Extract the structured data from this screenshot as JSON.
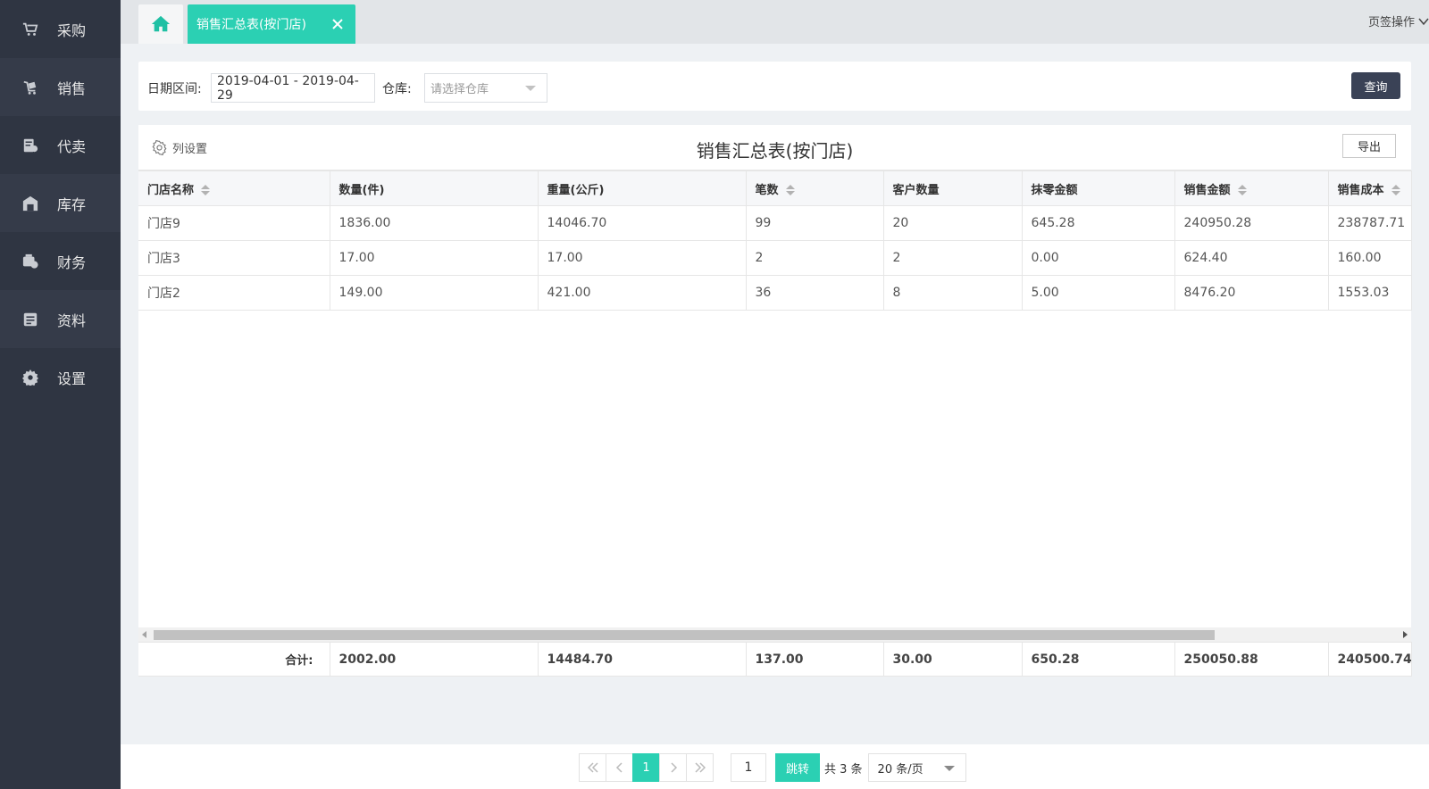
{
  "sidebar": {
    "items": [
      {
        "label": "采购",
        "icon": "cart-icon"
      },
      {
        "label": "销售",
        "icon": "sales-icon"
      },
      {
        "label": "代卖",
        "icon": "consign-icon"
      },
      {
        "label": "库存",
        "icon": "warehouse-icon"
      },
      {
        "label": "财务",
        "icon": "finance-icon"
      },
      {
        "label": "资料",
        "icon": "data-icon"
      },
      {
        "label": "设置",
        "icon": "gear-icon"
      }
    ]
  },
  "tabs": {
    "active_label": "销售汇总表(按门店)",
    "ops_label": "页签操作"
  },
  "filter": {
    "date_label": "日期区间:",
    "date_value": "2019-04-01 - 2019-04-29",
    "warehouse_label": "仓库:",
    "warehouse_placeholder": "请选择仓库",
    "query_label": "查询"
  },
  "report": {
    "column_settings_label": "列设置",
    "title": "销售汇总表(按门店)",
    "export_label": "导出",
    "columns": [
      "门店名称",
      "数量(件)",
      "重量(公斤)",
      "笔数",
      "客户数量",
      "抹零金额",
      "销售金额",
      "销售成本"
    ],
    "rows": [
      [
        "门店9",
        "1836.00",
        "14046.70",
        "99",
        "20",
        "645.28",
        "240950.28",
        "238787.71"
      ],
      [
        "门店3",
        "17.00",
        "17.00",
        "2",
        "2",
        "0.00",
        "624.40",
        "160.00"
      ],
      [
        "门店2",
        "149.00",
        "421.00",
        "36",
        "8",
        "5.00",
        "8476.20",
        "1553.03"
      ]
    ],
    "total_label": "合计:",
    "totals": [
      "2002.00",
      "14484.70",
      "137.00",
      "30.00",
      "650.28",
      "250050.88",
      "240500.74"
    ]
  },
  "pager": {
    "current_page": "1",
    "jump_value": "1",
    "jump_label": "跳转",
    "total_text": "共 3 条",
    "page_size": "20 条/页"
  },
  "colors": {
    "accent": "#2bd0b3",
    "sidebar_bg": "#2f3542",
    "query_button": "#3a4256"
  }
}
